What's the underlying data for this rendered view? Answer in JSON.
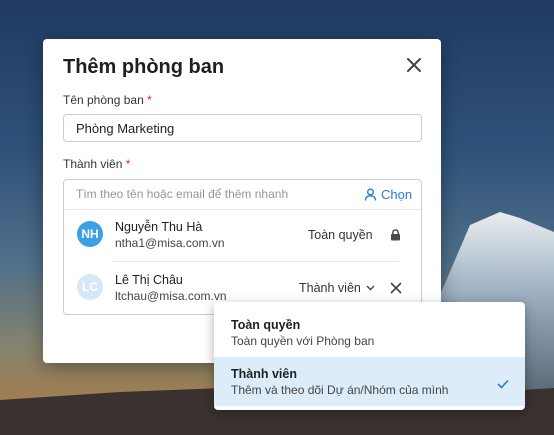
{
  "dialog": {
    "title": "Thêm phòng ban",
    "department_label": "Tên phòng ban",
    "required_mark": "*",
    "department_value": "Phòng Marketing",
    "members_label": "Thành viên",
    "search_placeholder": "Tìm theo tên hoặc email để thêm nhanh",
    "choose_label": "Chọn"
  },
  "members": [
    {
      "initials": "NH",
      "name": "Nguyễn Thu Hà",
      "email": "ntha1@misa.com.vn",
      "role": "Toàn quyền",
      "avatar_color": "#3ba0e6",
      "locked": true
    },
    {
      "initials": "LC",
      "name": "Lê Thị Châu",
      "email": "ltchau@misa.com.vn",
      "role": "Thành viên",
      "avatar_color": "#d6e8f6",
      "locked": false
    }
  ],
  "role_menu": {
    "options": [
      {
        "title": "Toàn quyền",
        "description": "Toàn quyền với Phòng ban",
        "selected": false
      },
      {
        "title": "Thành viên",
        "description": "Thêm và theo dõi Dự án/Nhóm của mình",
        "selected": true
      }
    ],
    "selected_color": "#dcecf9",
    "check_color": "#2b7bd3"
  },
  "icons": {
    "close": "close-icon",
    "choose": "person-icon",
    "lock": "lock-icon",
    "chevron": "chevron-down-icon",
    "remove": "close-icon",
    "check": "check-icon"
  }
}
